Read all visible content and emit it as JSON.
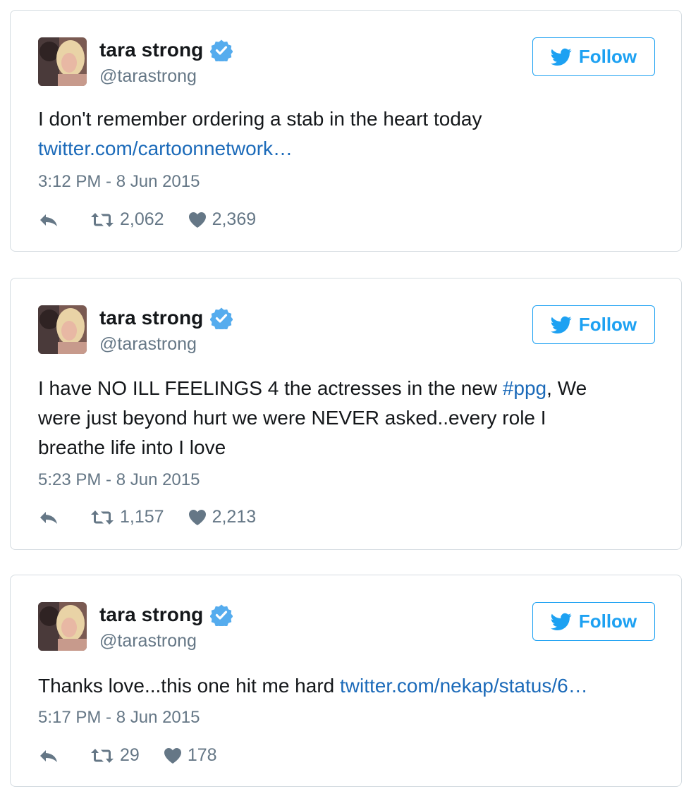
{
  "tweets": [
    {
      "name": "tara strong",
      "handle": "@tarastrong",
      "follow_label": "Follow",
      "text_lines": [
        "I don't remember ordering a stab in the heart today"
      ],
      "link": "twitter.com/cartoonnetwork…",
      "timestamp": "3:12 PM - 8 Jun 2015",
      "retweets": "2,062",
      "likes": "2,369"
    },
    {
      "name": "tara strong",
      "handle": "@tarastrong",
      "follow_label": "Follow",
      "text_before": "I have NO ILL FEELINGS 4 the actresses in the new ",
      "hashtag": "#ppg",
      "text_after": ", We",
      "text_line2": "were just beyond hurt we were NEVER asked..every role I",
      "text_line3": "breathe life into I love",
      "timestamp": "5:23 PM - 8 Jun 2015",
      "retweets": "1,157",
      "likes": "2,213"
    },
    {
      "name": "tara strong",
      "handle": "@tarastrong",
      "follow_label": "Follow",
      "text": "Thanks love...this one hit me hard ",
      "link": "twitter.com/nekap/status/6…",
      "timestamp": "5:17 PM - 8 Jun 2015",
      "retweets": "29",
      "likes": "178"
    }
  ],
  "colors": {
    "accent": "#1da1f2",
    "link": "#1b6ab9",
    "secondary_text": "#657786",
    "border": "#d5dce1"
  },
  "icons": [
    "verified-badge-icon",
    "twitter-bird-icon",
    "reply-icon",
    "retweet-icon",
    "heart-icon"
  ]
}
